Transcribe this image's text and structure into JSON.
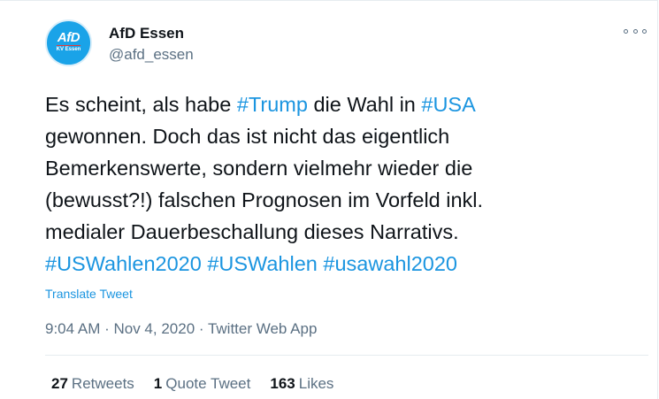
{
  "tweet": {
    "author": {
      "name": "AfD Essen",
      "handle": "@afd_essen",
      "avatar_main": "AfD",
      "avatar_sub": "KV Essen"
    },
    "text_parts": [
      "Es scheint, als habe ",
      "#Trump",
      " die Wahl in ",
      "#USA",
      "\ngewonnen. Doch das ist nicht das eigentlich\nBemerkenswerte, sondern vielmehr wieder die\n(bewusst?!) falschen Prognosen im Vorfeld inkl.\nmedialer Dauerbeschallung dieses Narrativs.\n",
      "#USWahlen2020",
      " ",
      "#USWahlen",
      " ",
      "#usawahl2020"
    ],
    "translate_label": "Translate Tweet",
    "timestamp": "9:04 AM · Nov 4, 2020 · Twitter Web App",
    "stats": {
      "retweets_count": "27",
      "retweets_label": "Retweets",
      "quotes_count": "1",
      "quotes_label": "Quote Tweet",
      "likes_count": "163",
      "likes_label": "Likes"
    }
  },
  "colors": {
    "link": "#1b95e0",
    "secondary": "#5b7083",
    "avatar_bg": "#1aa3e8"
  }
}
